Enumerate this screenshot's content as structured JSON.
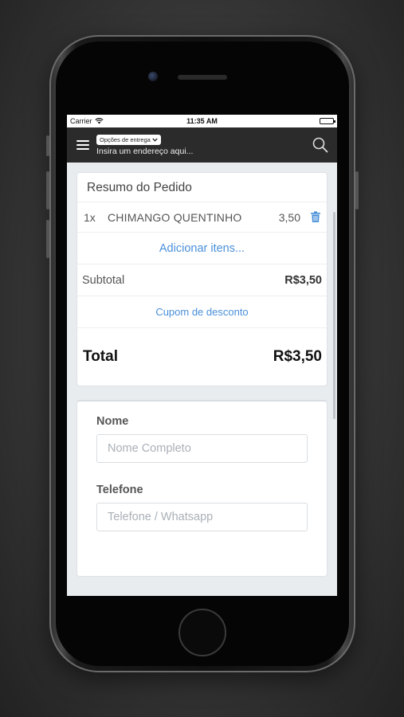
{
  "status_bar": {
    "carrier": "Carrier",
    "time": "11:35 AM"
  },
  "navbar": {
    "delivery_options": "Opções de entrega",
    "address_placeholder": "Insira um endereço aqui..."
  },
  "order_summary": {
    "title": "Resumo do Pedido",
    "items": [
      {
        "qty": "1x",
        "name": "CHIMANGO QUENTINHO",
        "price": "3,50"
      }
    ],
    "add_items_label": "Adicionar itens...",
    "subtotal_label": "Subtotal",
    "subtotal_value": "R$3,50",
    "coupon_label": "Cupom de desconto",
    "total_label": "Total",
    "total_value": "R$3,50"
  },
  "form": {
    "name_label": "Nome",
    "name_placeholder": "Nome Completo",
    "phone_label": "Telefone",
    "phone_placeholder": "Telefone / Whatsapp"
  },
  "colors": {
    "accent": "#4a90d9",
    "navbar": "#2b2b2b",
    "background": "#e9ecef"
  },
  "icons": [
    "wifi-icon",
    "battery-icon",
    "menu-icon",
    "chevron-down-icon",
    "search-icon",
    "trash-icon"
  ]
}
